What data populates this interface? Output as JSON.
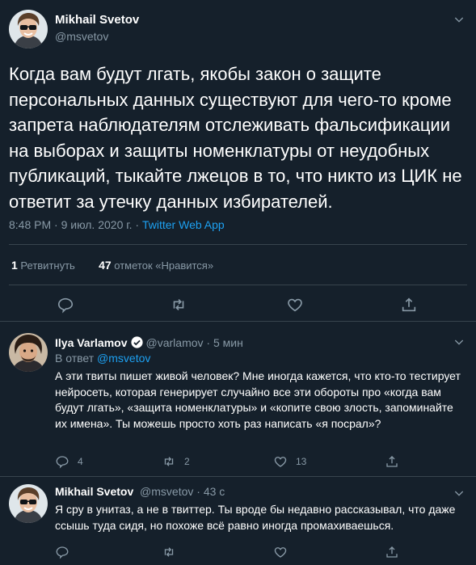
{
  "main_tweet": {
    "author_name": "Mikhail Svetov",
    "author_handle": "@msvetov",
    "text": "Когда вам будут лгать, якобы закон о защите персональных данных существуют для чего-то кроме запрета наблюдателям отслеживать фальсификации на выборах и защиты номенклатуры от неудобных публикаций, тыкайте лжецов в то, что никто из ЦИК не ответит за утечку данных избирателей.",
    "time": "8:48 PM · 9 июл. 2020 г. · ",
    "source": "Twitter Web App",
    "retweets_count": "1",
    "retweets_label": "Ретвитнуть",
    "likes_count": "47",
    "likes_label": "отметок «Нравится»"
  },
  "replies": [
    {
      "author_name": "Ilya Varlamov",
      "author_handle": "@varlamov · 5 мин",
      "reply_to_prefix": "В ответ ",
      "reply_to_mention": "@msvetov",
      "text": "А эти твиты пишет живой человек? Мне иногда кажется, что кто-то тестирует нейросеть, которая генерирует случайно все эти обороты про «когда вам будут лгать», «защита номенклатуры» и «копите свою злость, запоминайте их имена». Ты можешь просто хоть раз написать «я посрал»?",
      "reply_count": "4",
      "retweet_count": "2",
      "like_count": "13"
    },
    {
      "author_name": "Mikhail Svetov",
      "author_handle": "@msvetov · 43 с",
      "text": "Я сру в унитаз, а не в твиттер. Ты вроде бы недавно рассказывал, что даже ссышь туда сидя, но похоже всё равно иногда промахиваешься.",
      "reply_count": "",
      "retweet_count": "",
      "like_count": ""
    }
  ],
  "icons": [
    "chevron-down-icon",
    "reply-icon",
    "retweet-icon",
    "like-icon",
    "share-icon",
    "verified-badge-icon"
  ],
  "colors": {
    "background": "#15202b",
    "secondary_text": "#8899a6",
    "accent": "#1da1f2",
    "border": "#38444d"
  }
}
